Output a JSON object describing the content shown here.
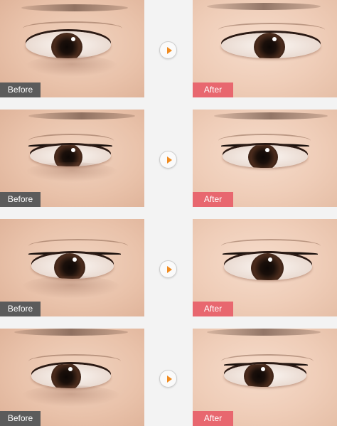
{
  "comparisons": [
    {
      "before_label": "Before",
      "after_label": "After"
    },
    {
      "before_label": "Before",
      "after_label": "After"
    },
    {
      "before_label": "Before",
      "after_label": "After"
    },
    {
      "before_label": "Before",
      "after_label": "After"
    }
  ],
  "colors": {
    "before_badge": "#5b5b5b",
    "after_badge": "#e8676f",
    "arrow_accent": "#f08a1e",
    "background": "#f3f3f3"
  },
  "icons": {
    "arrow": "chevron-right-icon"
  }
}
